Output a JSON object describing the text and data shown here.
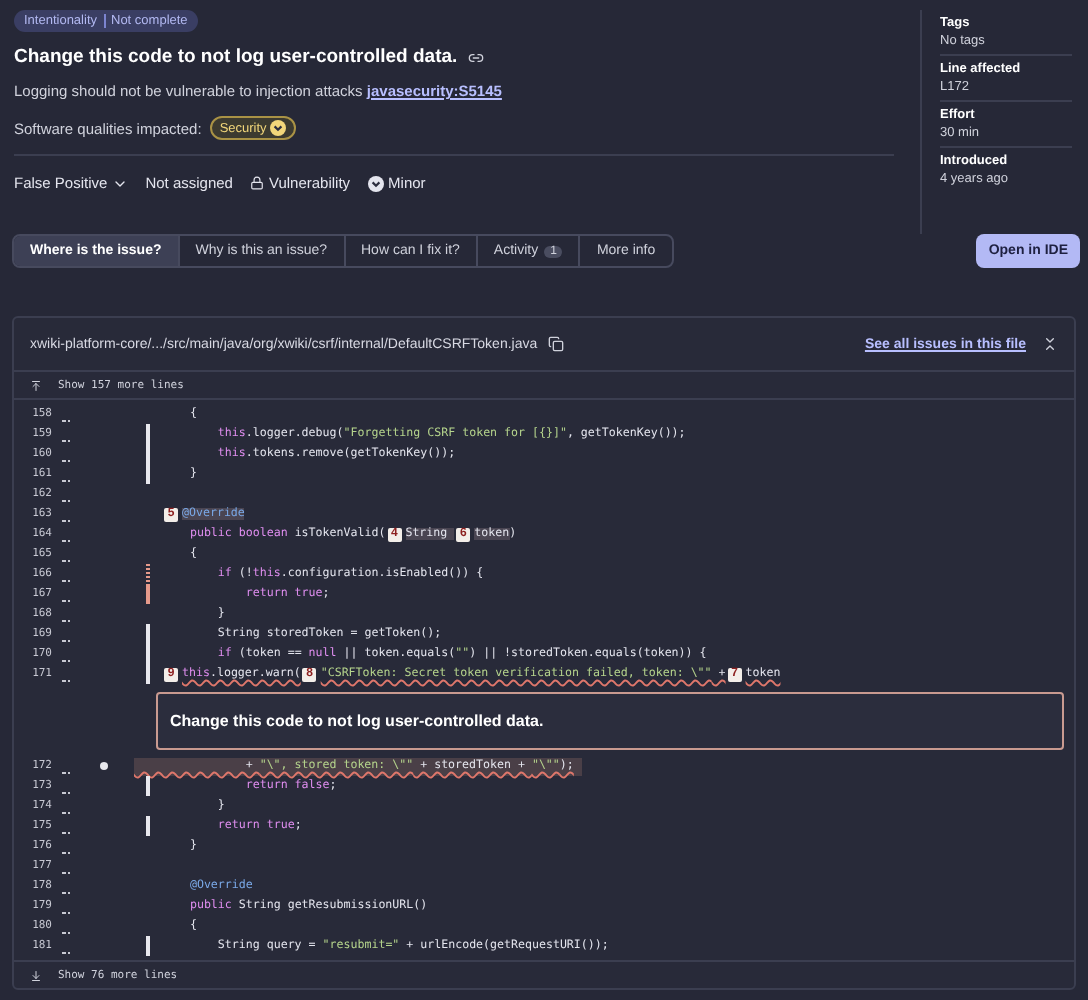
{
  "issue": {
    "badge": {
      "category": "Intentionality",
      "status": "Not complete"
    },
    "title": "Change this code to not log user-controlled data.",
    "description": "Logging should not be vulnerable to injection attacks",
    "rule_link": "javasecurity:S5145",
    "qualities_label": "Software qualities impacted:",
    "qualities": [
      {
        "label": "Security"
      }
    ],
    "status": "False Positive",
    "assignee": "Not assigned",
    "type": "Vulnerability",
    "severity": "Minor"
  },
  "sidebar": [
    {
      "label": "Tags",
      "value": "No tags"
    },
    {
      "label": "Line affected",
      "value": "L172"
    },
    {
      "label": "Effort",
      "value": "30 min"
    },
    {
      "label": "Introduced",
      "value": "4 years ago"
    }
  ],
  "tabs": [
    {
      "label": "Where is the issue?",
      "selected": true
    },
    {
      "label": "Why is this an issue?",
      "selected": false
    },
    {
      "label": "How can I fix it?",
      "selected": false
    },
    {
      "label": "Activity",
      "count": "1",
      "selected": false
    },
    {
      "label": "More info",
      "selected": false
    }
  ],
  "open_button": "Open in IDE",
  "file": {
    "path": "xwiki-platform-core/.../src/main/java/org/xwiki/csrf/internal/DefaultCSRFToken.java",
    "issues_link": "See all issues in this file",
    "show_above": "Show 157 more lines",
    "show_below": "Show 76 more lines",
    "lines": [
      {
        "kind": "code",
        "number": "158",
        "tokens": [
          {
            "kind": "plain",
            "text": "    {"
          }
        ]
      },
      {
        "kind": "code",
        "number": "159",
        "covered": true,
        "tokens": [
          {
            "kind": "keyword",
            "text": "        this"
          },
          {
            "kind": "plain",
            "text": ".logger.debug("
          },
          {
            "kind": "string",
            "text": "\"Forgetting CSRF token for [{}]\""
          },
          {
            "kind": "plain",
            "text": ", getTokenKey());"
          }
        ]
      },
      {
        "kind": "code",
        "number": "160",
        "covered": true,
        "tokens": [
          {
            "kind": "keyword",
            "text": "        this"
          },
          {
            "kind": "plain",
            "text": ".tokens.remove(getTokenKey());"
          }
        ]
      },
      {
        "kind": "code",
        "number": "161",
        "covered": true,
        "tokens": [
          {
            "kind": "plain",
            "text": "    }"
          }
        ]
      },
      {
        "kind": "code",
        "number": "162"
      },
      {
        "kind": "code",
        "number": "163",
        "tokens": [
          {
            "kind": "annotation",
            "text": "  @Override",
            "marker": "5",
            "highlighted": true
          }
        ]
      },
      {
        "kind": "code",
        "number": "164",
        "tokens": [
          {
            "kind": "keyword",
            "text": "    public boolean"
          },
          {
            "kind": "plain",
            "text": " isTokenValid("
          },
          {
            "kind": "plain",
            "text": "String ",
            "marker": "4",
            "highlighted": true
          },
          {
            "kind": "plain",
            "text": "token",
            "marker": "6",
            "highlighted": true
          },
          {
            "kind": "plain",
            "text": ")"
          }
        ]
      },
      {
        "kind": "code",
        "number": "165",
        "tokens": [
          {
            "kind": "plain",
            "text": "    {"
          }
        ]
      },
      {
        "kind": "code",
        "number": "166",
        "covered": false,
        "partial": true,
        "tokens": [
          {
            "kind": "keyword",
            "text": "        if"
          },
          {
            "kind": "plain",
            "text": " (!"
          },
          {
            "kind": "keyword",
            "text": "this"
          },
          {
            "kind": "plain",
            "text": ".configuration.isEnabled()) {"
          }
        ]
      },
      {
        "kind": "code",
        "number": "167",
        "covered": false,
        "tokens": [
          {
            "kind": "keyword",
            "text": "            return true"
          },
          {
            "kind": "plain",
            "text": ";"
          }
        ]
      },
      {
        "kind": "code",
        "number": "168",
        "tokens": [
          {
            "kind": "plain",
            "text": "        }"
          }
        ]
      },
      {
        "kind": "code",
        "number": "169",
        "covered": true,
        "tokens": [
          {
            "kind": "plain",
            "text": "        String storedToken = getToken();"
          }
        ]
      },
      {
        "kind": "code",
        "number": "170",
        "covered": true,
        "tokens": [
          {
            "kind": "keyword",
            "text": "        if"
          },
          {
            "kind": "plain",
            "text": " (token == "
          },
          {
            "kind": "keyword",
            "text": "null"
          },
          {
            "kind": "plain",
            "text": " || token.equals("
          },
          {
            "kind": "string",
            "text": "\"\""
          },
          {
            "kind": "plain",
            "text": ") || !storedToken.equals(token)) {"
          }
        ]
      },
      {
        "kind": "code",
        "number": "171",
        "covered": true,
        "tokens": [
          {
            "kind": "keyword",
            "text": "        this",
            "marker": "9",
            "flagged": true
          },
          {
            "kind": "plain",
            "text": ".logger.warn(",
            "flagged": true
          },
          {
            "kind": "string",
            "text": "\"CSRFToken: Secret token verification failed, token: \\\"\"",
            "marker": "8",
            "flagged": true
          },
          {
            "kind": "plain",
            "text": " +",
            "flagged": true
          },
          {
            "kind": "plain",
            "text": "token",
            "marker": "7",
            "flagged": true
          }
        ]
      },
      {
        "kind": "message",
        "text": "Change this code to not log user-controlled data."
      },
      {
        "kind": "code",
        "number": "172",
        "issue": true,
        "tokens": [
          {
            "kind": "plain",
            "text": "                + "
          },
          {
            "kind": "string",
            "text": "\"\\\", stored token: \\\"\""
          },
          {
            "kind": "plain",
            "text": " + storedToken + "
          },
          {
            "kind": "string",
            "text": "\"\\\"\""
          },
          {
            "kind": "plain",
            "text": ");"
          }
        ]
      },
      {
        "kind": "code",
        "number": "173",
        "covered": true,
        "tokens": [
          {
            "kind": "keyword",
            "text": "            return false"
          },
          {
            "kind": "plain",
            "text": ";"
          }
        ]
      },
      {
        "kind": "code",
        "number": "174",
        "tokens": [
          {
            "kind": "plain",
            "text": "        }"
          }
        ]
      },
      {
        "kind": "code",
        "number": "175",
        "covered": true,
        "tokens": [
          {
            "kind": "keyword",
            "text": "        return true"
          },
          {
            "kind": "plain",
            "text": ";"
          }
        ]
      },
      {
        "kind": "code",
        "number": "176",
        "tokens": [
          {
            "kind": "plain",
            "text": "    }"
          }
        ]
      },
      {
        "kind": "code",
        "number": "177"
      },
      {
        "kind": "code",
        "number": "178",
        "tokens": [
          {
            "kind": "annotation",
            "text": "    @Override"
          }
        ]
      },
      {
        "kind": "code",
        "number": "179",
        "tokens": [
          {
            "kind": "keyword",
            "text": "    public"
          },
          {
            "kind": "plain",
            "text": " String getResubmissionURL()"
          }
        ]
      },
      {
        "kind": "code",
        "number": "180",
        "tokens": [
          {
            "kind": "plain",
            "text": "    {"
          }
        ]
      },
      {
        "kind": "code",
        "number": "181",
        "covered": true,
        "tokens": [
          {
            "kind": "plain",
            "text": "        String query = "
          },
          {
            "kind": "string",
            "text": "\"resubmit=\""
          },
          {
            "kind": "plain",
            "text": " + urlEncode(getRequestURI());"
          }
        ]
      }
    ]
  }
}
